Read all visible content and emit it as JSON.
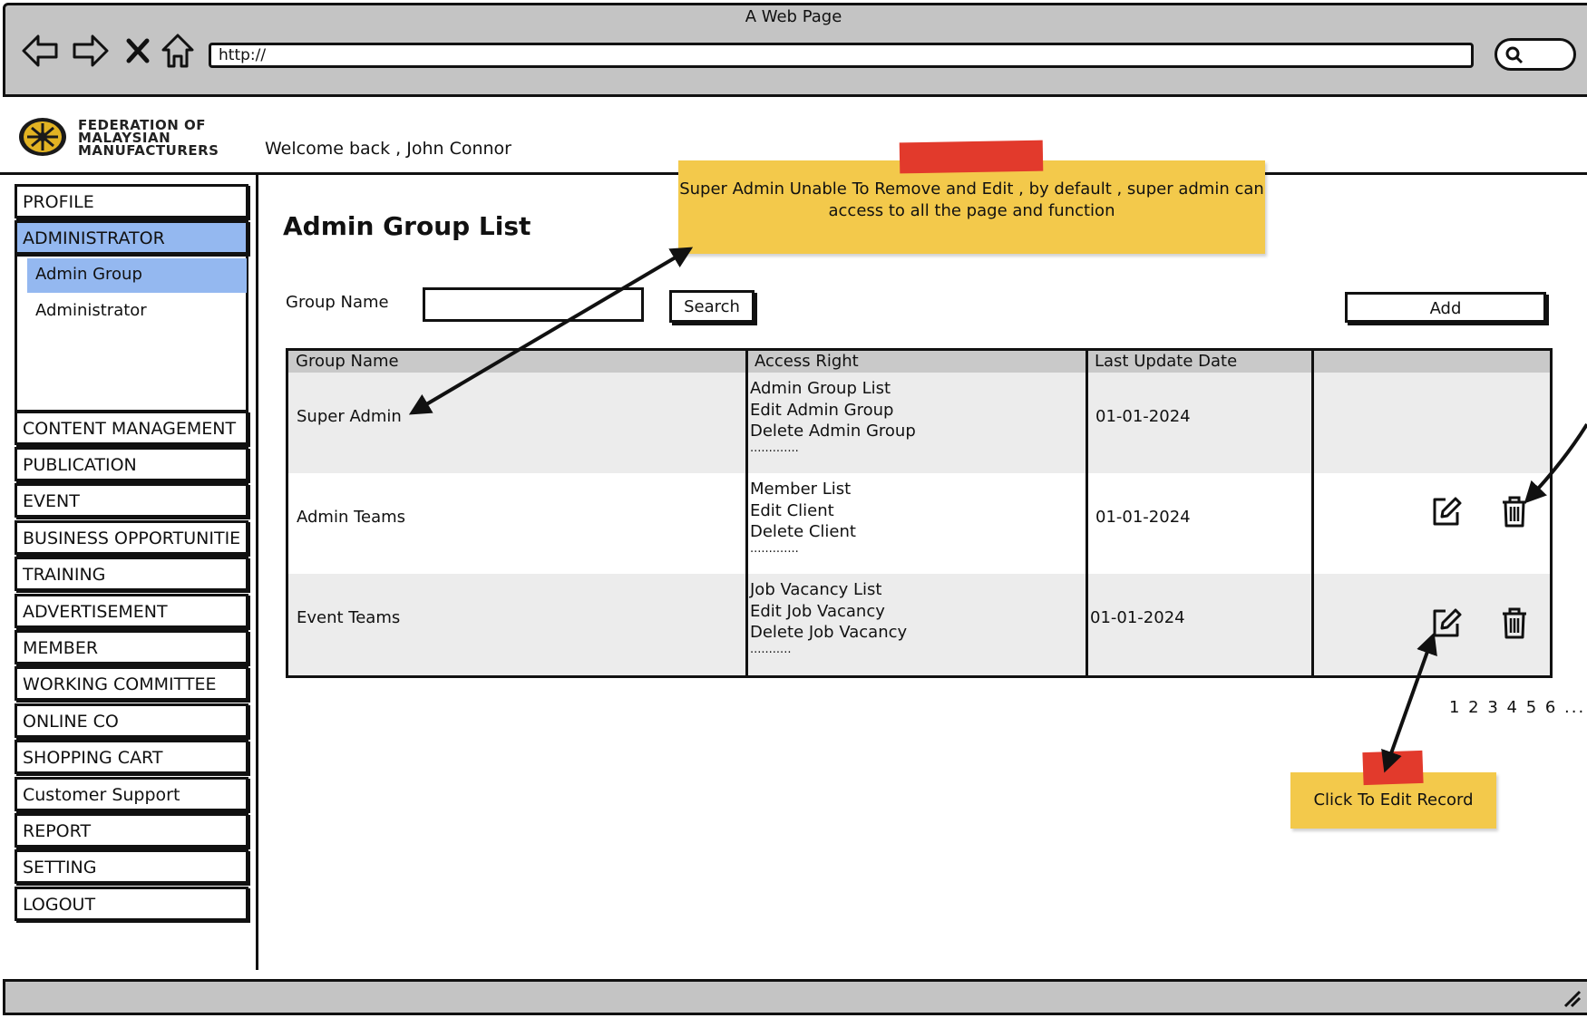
{
  "window": {
    "title": "A Web Page"
  },
  "browser": {
    "url": "http://",
    "nav_icons": [
      "back-arrow-icon",
      "forward-arrow-icon",
      "close-x-icon",
      "home-icon",
      "search-icon"
    ]
  },
  "header": {
    "logo_text": "FEDERATION OF\nMALAYSIAN\nMANUFACTURERS",
    "welcome": "Welcome back , John Connor"
  },
  "sidebar": {
    "top_items": [
      {
        "label": "PROFILE",
        "active": false
      },
      {
        "label": "ADMINISTRATOR",
        "active": true
      }
    ],
    "sub_items": [
      {
        "label": "Admin Group",
        "active": true
      },
      {
        "label": "Administrator",
        "active": false
      }
    ],
    "items": [
      {
        "label": "CONTENT MANAGEMENT"
      },
      {
        "label": "PUBLICATION"
      },
      {
        "label": "EVENT"
      },
      {
        "label": "BUSINESS OPPORTUNITIE"
      },
      {
        "label": "TRAINING"
      },
      {
        "label": "ADVERTISEMENT"
      },
      {
        "label": "MEMBER"
      },
      {
        "label": "WORKING COMMITTEE"
      },
      {
        "label": "ONLINE CO"
      },
      {
        "label": "SHOPPING CART"
      },
      {
        "label": "Customer Support"
      },
      {
        "label": "REPORT"
      },
      {
        "label": "SETTING"
      },
      {
        "label": "LOGOUT"
      }
    ]
  },
  "main": {
    "title": "Admin Group List",
    "filter": {
      "label": "Group Name",
      "value": "",
      "search_label": "Search"
    },
    "add_label": "Add",
    "table": {
      "headers": [
        "Group Name",
        "Access Right",
        "Last Update Date",
        ""
      ],
      "rows": [
        {
          "group": "Super Admin",
          "rights": [
            "Admin Group List",
            "Edit Admin Group",
            "Delete Admin Group",
            "............."
          ],
          "date": "01-01-2024",
          "actions": false
        },
        {
          "group": "Admin Teams",
          "rights": [
            "Member List",
            "Edit Client",
            "Delete Client",
            "............."
          ],
          "date": "01-01-2024",
          "actions": true
        },
        {
          "group": "Event Teams",
          "rights": [
            "Job Vacancy List",
            "Edit Job Vacancy",
            "Delete Job Vacancy",
            "..........."
          ],
          "date": "01-01-2024",
          "actions": true
        }
      ]
    },
    "pagination": "1 2 3 4 5 6 ..."
  },
  "notes": {
    "super_admin": "Super Admin Unable To Remove and Edit , by default , super admin can access to all the page and function",
    "edit_record": "Click To Edit Record"
  },
  "colors": {
    "active_menu": "#94b8f0",
    "note": "#f3c94b",
    "tape": "#e23a2c",
    "chrome": "#c4c4c4"
  }
}
